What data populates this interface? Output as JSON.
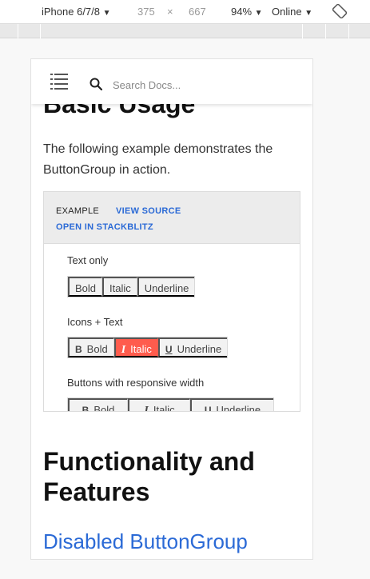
{
  "devtools": {
    "device": "iPhone 6/7/8",
    "width": "375",
    "times": "×",
    "height": "667",
    "zoom": "94%",
    "network": "Online"
  },
  "nav": {
    "search_placeholder": "Search Docs..."
  },
  "page": {
    "section_title_cut": "Basic Usage",
    "lead": "The following example demonstrates the ButtonGroup in action.",
    "example": {
      "label": "EXAMPLE",
      "view_source": "VIEW SOURCE",
      "open_stackblitz": "OPEN IN STACKBLITZ",
      "groups": [
        {
          "title": "Text only",
          "buttons": [
            "Bold",
            "Italic",
            "Underline"
          ]
        },
        {
          "title": "Icons + Text",
          "buttons": [
            "Bold",
            "Italic",
            "Underline"
          ],
          "icons": [
            "B",
            "I",
            "U"
          ],
          "active_index": 1
        },
        {
          "title": "Buttons with responsive width",
          "buttons": [
            "Bold",
            "Italic",
            "Underline"
          ],
          "icons": [
            "B",
            "I",
            "U"
          ]
        }
      ]
    },
    "heading2": "Functionality and Features",
    "subheading": "Disabled ButtonGroup"
  },
  "colors": {
    "accent_active": "#ff5c4d",
    "link": "#2b6ad6"
  }
}
